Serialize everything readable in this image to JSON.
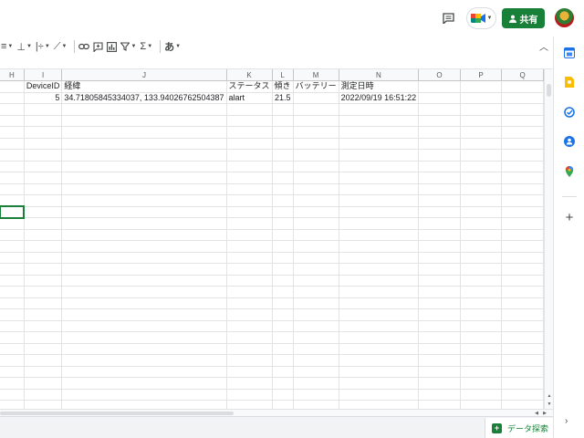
{
  "header": {
    "share_label": "共有"
  },
  "toolbar": {
    "items": [
      {
        "name": "align-horizontal",
        "glyph": "≡"
      },
      {
        "name": "align-vertical",
        "glyph": "⊥"
      },
      {
        "name": "text-wrap",
        "glyph": "|÷"
      },
      {
        "name": "text-rotation",
        "glyph": "⟋"
      }
    ],
    "input_tools_glyph": "あ",
    "function_glyph": "Σ"
  },
  "grid": {
    "columns": [
      "H",
      "I",
      "J",
      "K",
      "L",
      "M",
      "N",
      "O",
      "P",
      "Q"
    ],
    "rows": [
      [
        "",
        "DeviceID",
        "経緯",
        "ステータス",
        "傾き",
        "バッテリー",
        "測定日時",
        "",
        "",
        ""
      ],
      [
        "",
        "5",
        "34.71805845334037, 133.94026762504387",
        "alart",
        "21.5",
        "",
        "2022/09/19 16:51:22",
        "",
        "",
        ""
      ]
    ],
    "selected_row": 11,
    "selected_col": 0
  },
  "bottom": {
    "explore_label": "データ探索"
  },
  "colors": {
    "accent": "#188038",
    "grid_line": "#e2e3e3",
    "header_bg": "#f8f9fa"
  }
}
